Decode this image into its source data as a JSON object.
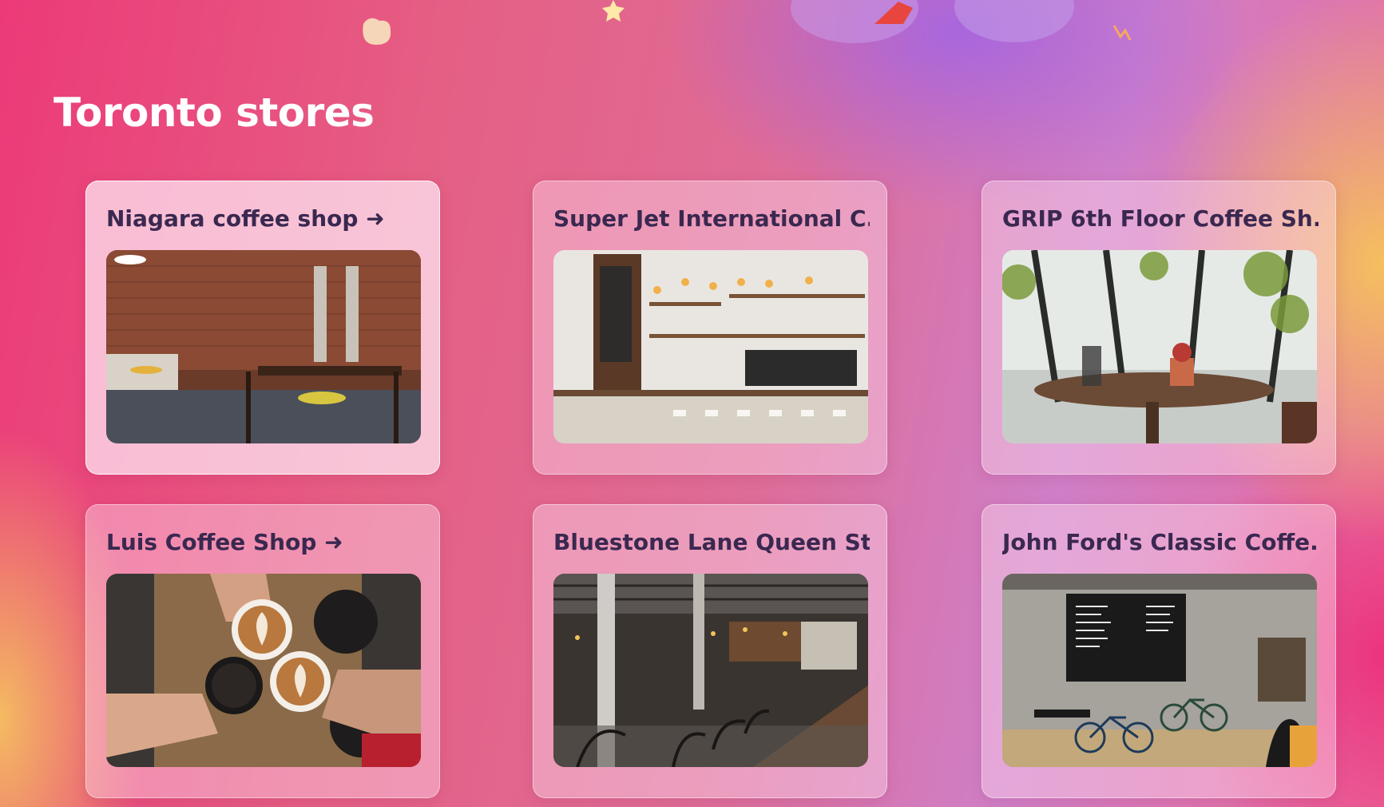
{
  "page": {
    "title": "Toronto stores"
  },
  "stores": [
    {
      "name": "Niagara coffee shop ➜",
      "photo": "coffee-shop-brick-wall-photo"
    },
    {
      "name": "Super Jet International C...",
      "photo": "cafe-counter-pendant-lights-photo"
    },
    {
      "name": "GRIP 6th Floor Coffee Sh...",
      "photo": "window-table-french-press-photo"
    },
    {
      "name": "Luis Coffee Shop ➜",
      "photo": "latte-cheers-hands-photo"
    },
    {
      "name": "Bluestone Lane Queen St...",
      "photo": "industrial-cafe-long-table-photo"
    },
    {
      "name": "John Ford's Classic Coffe...",
      "photo": "cafe-menu-board-bicycles-photo"
    }
  ],
  "colors": {
    "title": "#ffffff",
    "card_text": "#3a2850",
    "background_pink": "#ec3a78",
    "background_purple": "#a064e6",
    "background_yellow": "#f6c45a"
  }
}
